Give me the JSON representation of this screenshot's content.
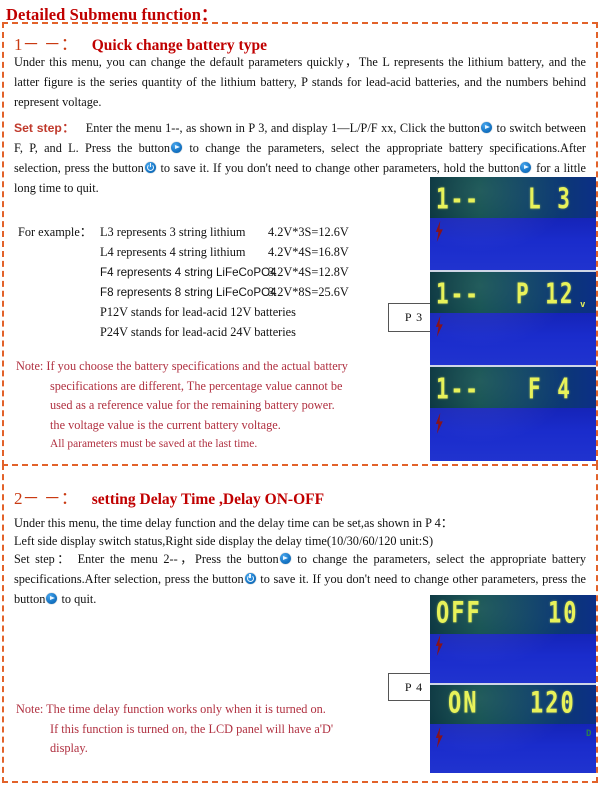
{
  "document": {
    "title": "Detailed Submenu function："
  },
  "sections": [
    {
      "number": "1－ －：",
      "title": "Quick change battery type",
      "intro": "Under this menu, you can change the default parameters quickly，The L represents the lithium battery, and the latter figure is the series quantity of the lithium battery, P stands for lead-acid batteries, and the numbers behind represent voltage.",
      "set_step_label": "Set step：",
      "set_step_part1": "Enter the menu 1--, as shown in P 3, and display 1—L/P/F xx, Click the button",
      "set_step_part2": "to switch between F, P, and L. Press the button",
      "set_step_part3": "to change the parameters, select the appropriate battery specifications.After    selection, press the button",
      "set_step_part4": "to save it. If you don't need to change other parameters, hold the button",
      "set_step_part5": "for a little long time to quit.",
      "example_label": "For example：",
      "examples": [
        {
          "desc": "L3 represents 3 string lithium",
          "calc": "4.2V*3S=12.6V",
          "sans": false
        },
        {
          "desc": "L4 represents 4 string lithium",
          "calc": "4.2V*4S=16.8V",
          "sans": false
        },
        {
          "desc": "F4 represents 4 string LiFeCoPO4",
          "calc": "3.2V*4S=12.8V",
          "sans": true
        },
        {
          "desc": "F8 represents 8 string LiFeCoPO4",
          "calc": "3.2V*8S=25.6V",
          "sans": true
        },
        {
          "desc": "P12V stands for lead-acid 12V batteries",
          "calc": "",
          "sans": false
        },
        {
          "desc": "P24V stands for lead-acid 24V batteries",
          "calc": "",
          "sans": false
        }
      ],
      "note_lines": [
        "Note: If you choose the battery specifications and the actual battery",
        "specifications are different, The percentage value cannot be",
        "used as a reference value for the remaining battery power.",
        "the voltage value is the current battery voltage.",
        "All parameters must be saved at the last time."
      ],
      "photo_label": "P 3"
    },
    {
      "number": "2－ －：",
      "title": "setting Delay Time ,Delay ON-OFF",
      "line1": "Under this menu, the time delay function and the delay time can be set,as shown in P 4：",
      "line2": "Left side display switch status,Right side display the delay time(10/30/60/120 unit:S)",
      "set_step_label": "Set step：",
      "set_step_part1": "Enter the menu 2--，Press the button",
      "set_step_part2": "to change the parameters, select the appropriate battery specifications.After    selection, press the button",
      "set_step_part3": "to save it. If you don't need to change other parameters, press the button",
      "set_step_part4": "to quit.",
      "note_lines": [
        "Note: The time delay function works only when it is turned on.",
        "If this function is turned on, the LCD panel will have a'D'",
        "display."
      ],
      "photo_label": "P 4"
    }
  ],
  "lcd_screens_top": [
    {
      "left": "1--",
      "right": "L 3",
      "unit": ""
    },
    {
      "left": "1--",
      "right": "P 12",
      "unit": "v"
    },
    {
      "left": "1--",
      "right": "F 4",
      "unit": ""
    }
  ],
  "lcd_screens_bottom": [
    {
      "left": "OFF",
      "right": "10",
      "unit": ""
    },
    {
      "left": "ON",
      "right": "120",
      "unit": "D"
    }
  ],
  "icons": {
    "play_button": "play-button-icon",
    "power_button": "power-button-icon",
    "bolt": "lightning-bolt-icon"
  },
  "colors": {
    "title_red": "#c00000",
    "frame_orange": "#e2622a",
    "note_red": "#b03040",
    "lcd_yellow": "#e8f25a",
    "lcd_blue": "#1a2ccc",
    "button_blue": "#1878c8"
  }
}
